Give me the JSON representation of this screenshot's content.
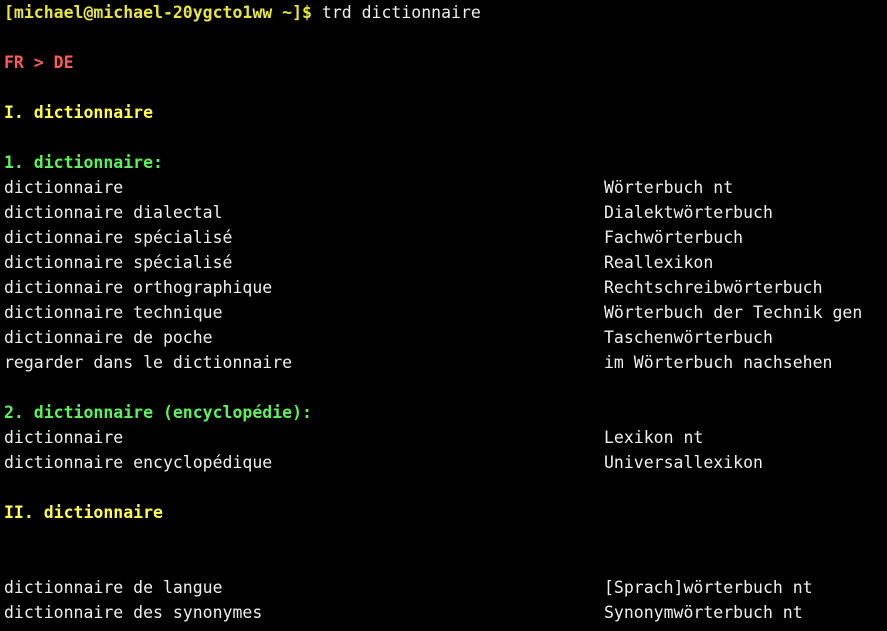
{
  "prompt": {
    "user_host": "[michael@michael-20ygcto1ww ~]$",
    "command": "trd dictionnaire"
  },
  "colors": {
    "prompt": "#e8e63a",
    "lang": "#ff5b5b",
    "section": "#ffff4a",
    "sense": "#5cf25c",
    "text": "#f0f0f0",
    "background": "#000000"
  },
  "lang_pair": "FR > DE",
  "sections": [
    {
      "title": "I. dictionnaire",
      "senses": [
        {
          "title": "1. dictionnaire:",
          "entries": [
            {
              "fr": "dictionnaire",
              "de": "Wörterbuch nt"
            },
            {
              "fr": "dictionnaire dialectal",
              "de": "Dialektwörterbuch"
            },
            {
              "fr": "dictionnaire spécialisé",
              "de": "Fachwörterbuch"
            },
            {
              "fr": "dictionnaire spécialisé",
              "de": "Reallexikon"
            },
            {
              "fr": "dictionnaire orthographique",
              "de": "Rechtschreibwörterbuch"
            },
            {
              "fr": "dictionnaire technique",
              "de": "Wörterbuch der Technik gen"
            },
            {
              "fr": "dictionnaire de poche",
              "de": "Taschenwörterbuch"
            },
            {
              "fr": "regarder dans le dictionnaire",
              "de": "im Wörterbuch nachsehen"
            }
          ]
        },
        {
          "title": "2. dictionnaire (encyclopédie):",
          "entries": [
            {
              "fr": "dictionnaire",
              "de": "Lexikon nt"
            },
            {
              "fr": "dictionnaire encyclopédique",
              "de": "Universallexikon"
            }
          ]
        }
      ]
    },
    {
      "title": "II. dictionnaire",
      "entries": [
        {
          "fr": "dictionnaire de langue",
          "de": "[Sprach]wörterbuch nt"
        },
        {
          "fr": "dictionnaire des synonymes",
          "de": "Synonymwörterbuch nt"
        }
      ]
    }
  ]
}
